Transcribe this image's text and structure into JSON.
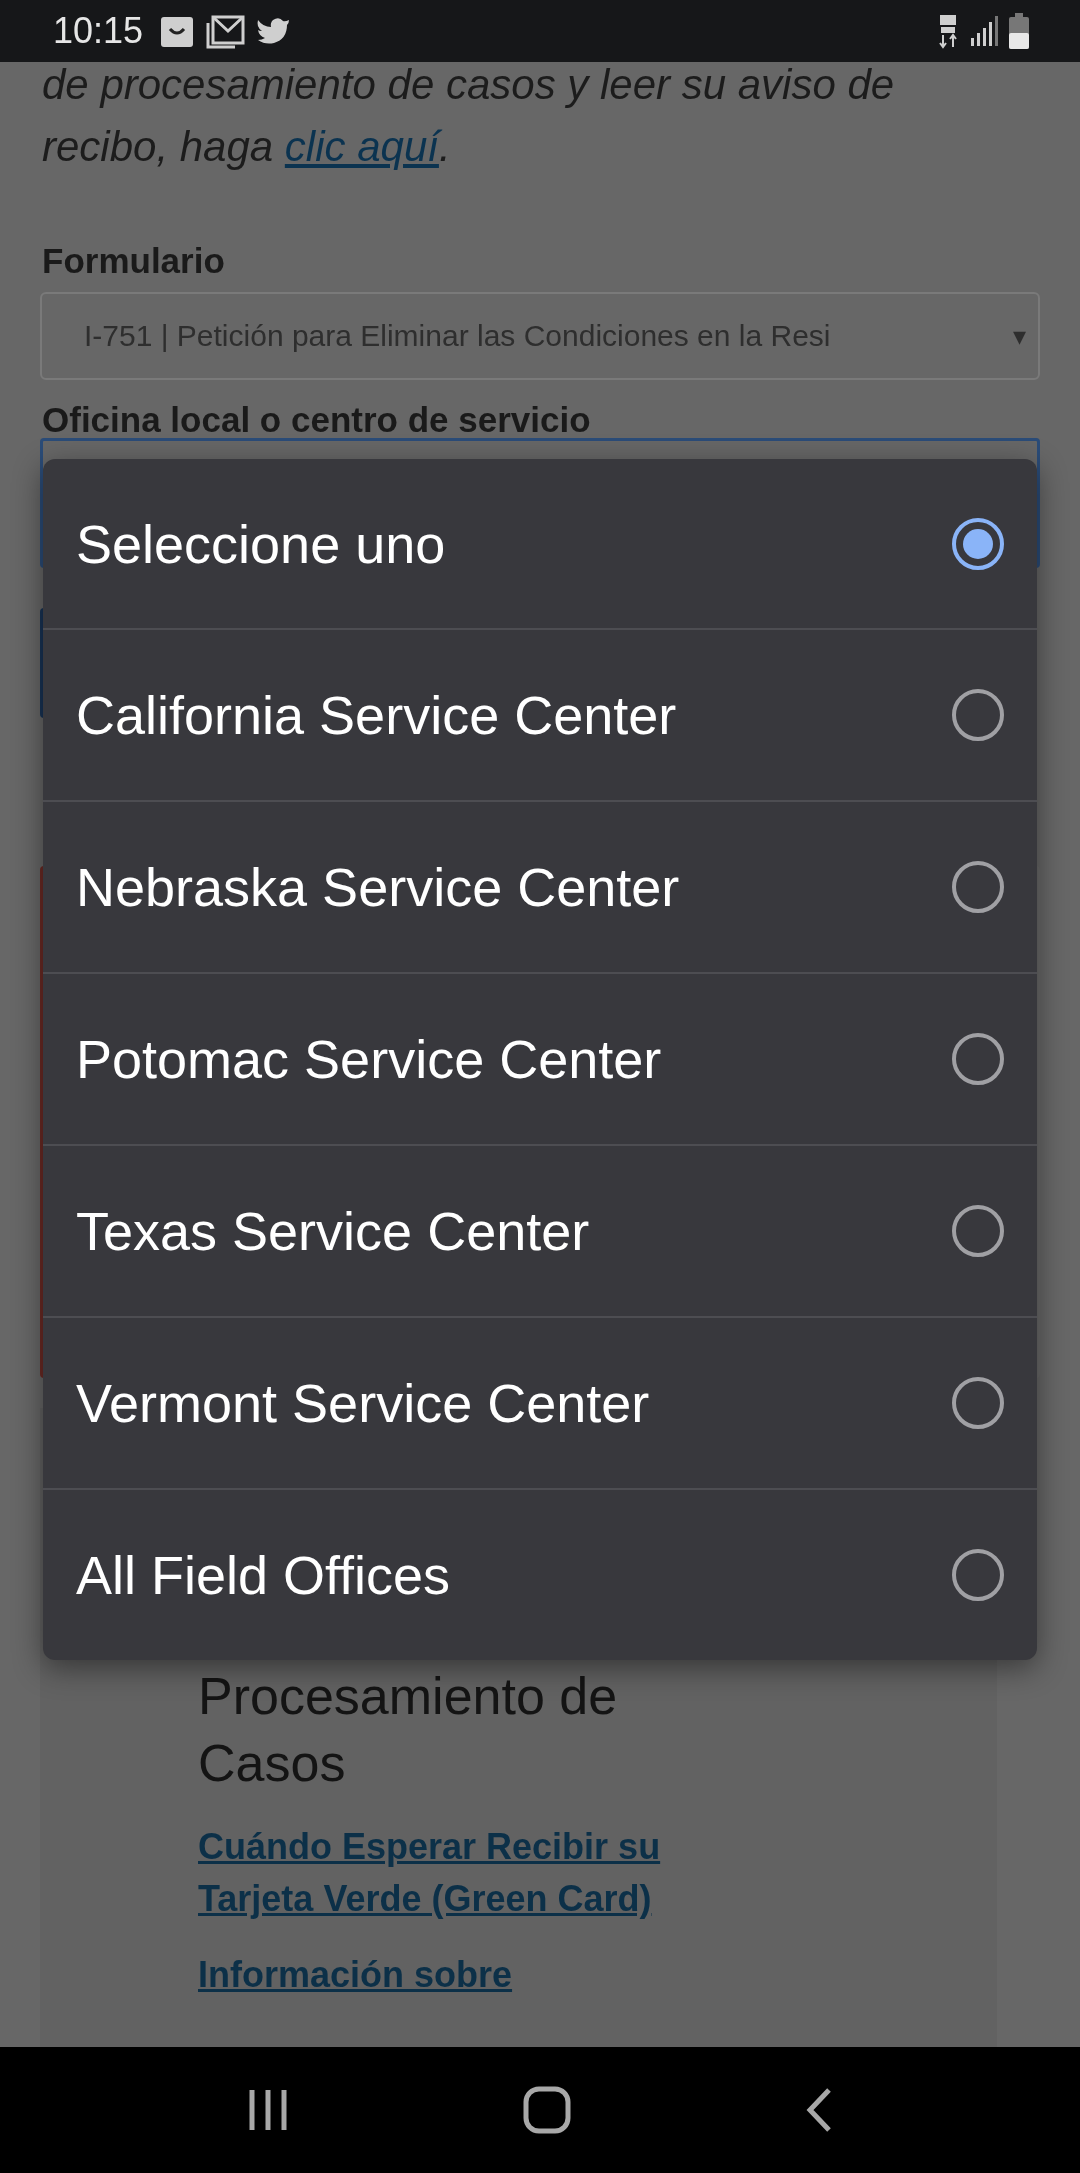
{
  "status_bar": {
    "time": "10:15"
  },
  "intro": {
    "text": "de procesamiento de casos y leer su aviso de recibo, haga ",
    "link": "clic aquí",
    "tail": "."
  },
  "form_field": {
    "label": "Formulario",
    "value": "I-751 | Petición para Eliminar las Condiciones en la Resi",
    "caret": "▾"
  },
  "office_field": {
    "label": "Oficina local o centro de servicio"
  },
  "picker": {
    "options": [
      {
        "label": "Seleccione uno",
        "selected": true
      },
      {
        "label": "California Service Center",
        "selected": false
      },
      {
        "label": "Nebraska Service Center",
        "selected": false
      },
      {
        "label": "Potomac Service Center",
        "selected": false
      },
      {
        "label": "Texas Service Center",
        "selected": false
      },
      {
        "label": "Vermont Service Center",
        "selected": false
      },
      {
        "label": "All Field Offices",
        "selected": false
      }
    ]
  },
  "info_card": {
    "heading": "Procesamiento de Casos",
    "links": [
      "Cuándo Esperar Recibir su Tarjeta Verde (Green Card)",
      "Información sobre"
    ]
  }
}
